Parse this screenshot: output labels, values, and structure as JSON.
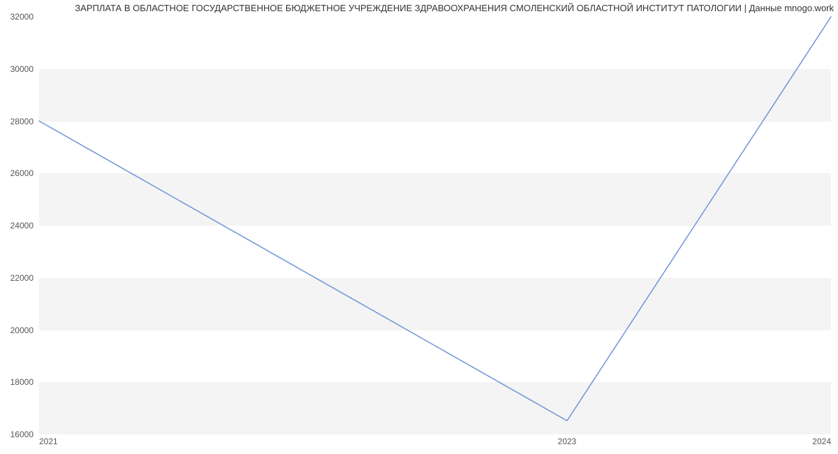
{
  "title": "ЗАРПЛАТА В ОБЛАСТНОЕ ГОСУДАРСТВЕННОЕ БЮДЖЕТНОЕ УЧРЕЖДЕНИЕ ЗДРАВООХРАНЕНИЯ СМОЛЕНСКИЙ ОБЛАСТНОЙ ИНСТИТУТ ПАТОЛОГИИ | Данные mnogo.work",
  "chart_data": {
    "type": "line",
    "x": [
      2021,
      2023,
      2024
    ],
    "values": [
      28000,
      16500,
      32000
    ],
    "x_ticks": [
      2021,
      2023,
      2024
    ],
    "y_ticks": [
      16000,
      18000,
      20000,
      22000,
      24000,
      26000,
      28000,
      30000,
      32000
    ],
    "ylim": [
      16000,
      32000
    ],
    "xlim": [
      2021,
      2024
    ],
    "bands": [
      [
        16000,
        18000
      ],
      [
        20000,
        22000
      ],
      [
        24000,
        26000
      ],
      [
        28000,
        30000
      ]
    ]
  }
}
